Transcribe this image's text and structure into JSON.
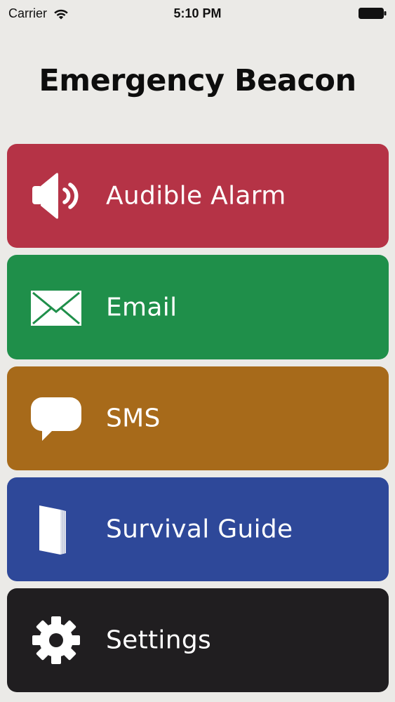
{
  "status_bar": {
    "carrier": "Carrier",
    "time": "5:10 PM"
  },
  "header": {
    "title": "Emergency Beacon"
  },
  "menu": {
    "items": [
      {
        "label": "Audible Alarm",
        "icon": "speaker-icon",
        "color": "#b53346"
      },
      {
        "label": "Email",
        "icon": "envelope-icon",
        "color": "#1f8f4a"
      },
      {
        "label": "SMS",
        "icon": "speech-bubble-icon",
        "color": "#a76a1a"
      },
      {
        "label": "Survival Guide",
        "icon": "book-icon",
        "color": "#2e4899"
      },
      {
        "label": "Settings",
        "icon": "gear-icon",
        "color": "#201e20"
      }
    ]
  }
}
